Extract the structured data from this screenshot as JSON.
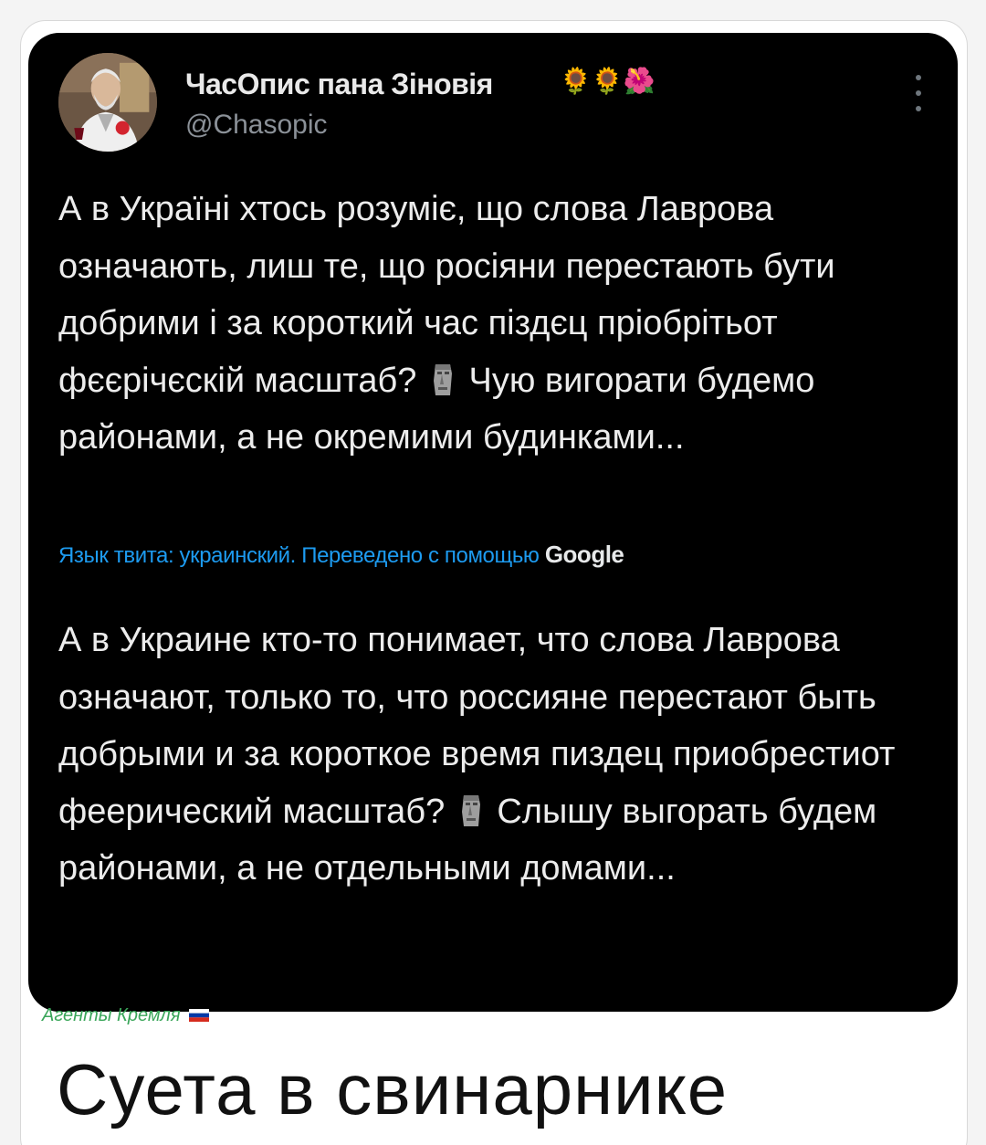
{
  "tweet": {
    "display_name": "ЧасОпис пана Зіновія",
    "name_emojis": "🌻🌻🌺",
    "handle": "@Chasopic",
    "text": "А в Україні хтось розуміє, що слова Лаврова означають, лиш те, що росіяни перестають бути добрими і за короткий час піздєц пріобрітьот фєєрічєскій масштаб?",
    "text_after_emoji": "Чую вигорати будемо районами, а не окремими будинками...",
    "translation_note": "Язык твита: украинский. Переведено с помощью",
    "translation_brand": "Google",
    "translated_text": "А в Украине кто-то понимает, что слова Лаврова означают, только то, что россияне перестают быть добрыми и за короткое время пиздец приобрестиот феерический масштаб?",
    "translated_text_after_emoji": "Слышу выгорать будем районами, а не отдельными домами...",
    "icons": {
      "avatar": "profile-photo",
      "more": "more-options-icon",
      "emoji": "moai-icon"
    }
  },
  "watermark": {
    "text": "Агенты Кремля",
    "flag": "russian-flag-icon"
  },
  "caption": {
    "text": "Суета в свинарнике"
  },
  "colors": {
    "card_background": "#000000",
    "text": "#ececec",
    "handle": "#8b9198",
    "link": "#1d9bf0",
    "watermark": "#3aa65a",
    "caption": "#111111"
  }
}
